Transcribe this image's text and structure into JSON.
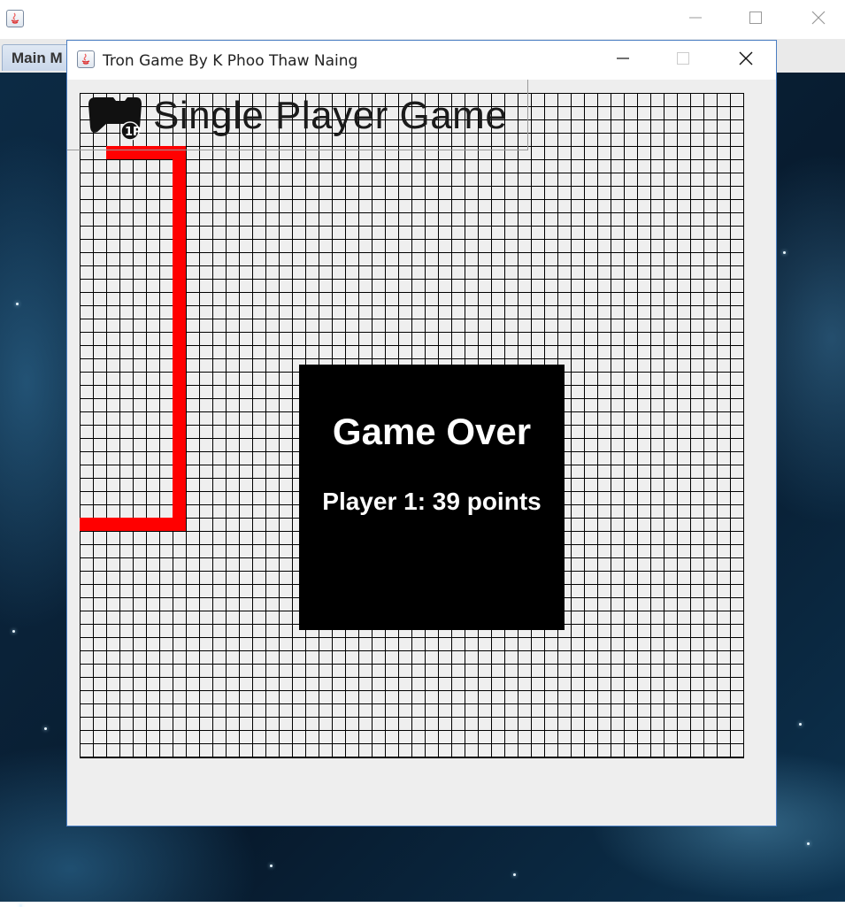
{
  "outer_window": {
    "tab_label": "Main M",
    "controls": [
      "minimize-icon",
      "maximize-icon",
      "close-icon"
    ]
  },
  "game_window": {
    "title": "Tron Game By K Phoo Thaw Naing",
    "controls": [
      "minimize-icon",
      "maximize-icon",
      "close-icon"
    ],
    "header": {
      "icon": "gamepad-icon",
      "title": "Single Player Game"
    },
    "board": {
      "columns": 50,
      "rows": 50,
      "background_color": "#efefef",
      "grid_line_color": "#000000",
      "player1_trail_color": "#ff0000"
    },
    "game_over": {
      "heading": "Game Over",
      "score_text": "Player 1: 39 points"
    }
  }
}
